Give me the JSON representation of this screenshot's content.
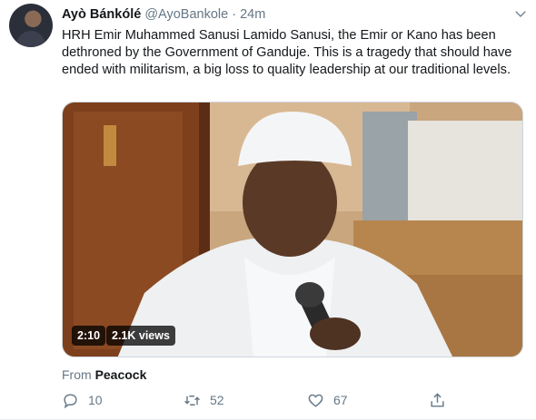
{
  "tweet": {
    "display_name": "Ayò Bánkólé",
    "handle": "@AyoBankole",
    "separator": "·",
    "time": "24m",
    "text": "HRH Emir Muhammed Sanusi Lamido Sanusi, the Emir or Kano has been dethroned by the Government of Ganduje. This is a tragedy that should have ended with militarism, a big loss to quality leadership at our traditional levels.",
    "media": {
      "duration": "2:10",
      "views": "2.1K views"
    },
    "source_prefix": "From",
    "source_name": "Peacock",
    "actions": {
      "replies": "10",
      "retweets": "52",
      "likes": "67"
    }
  },
  "icons": {
    "caret": "chevron-down-icon",
    "reply": "reply-icon",
    "retweet": "retweet-icon",
    "like": "heart-icon",
    "share": "share-icon"
  },
  "colors": {
    "text_primary": "#14171a",
    "text_secondary": "#657786",
    "border": "#e6ecf0"
  }
}
